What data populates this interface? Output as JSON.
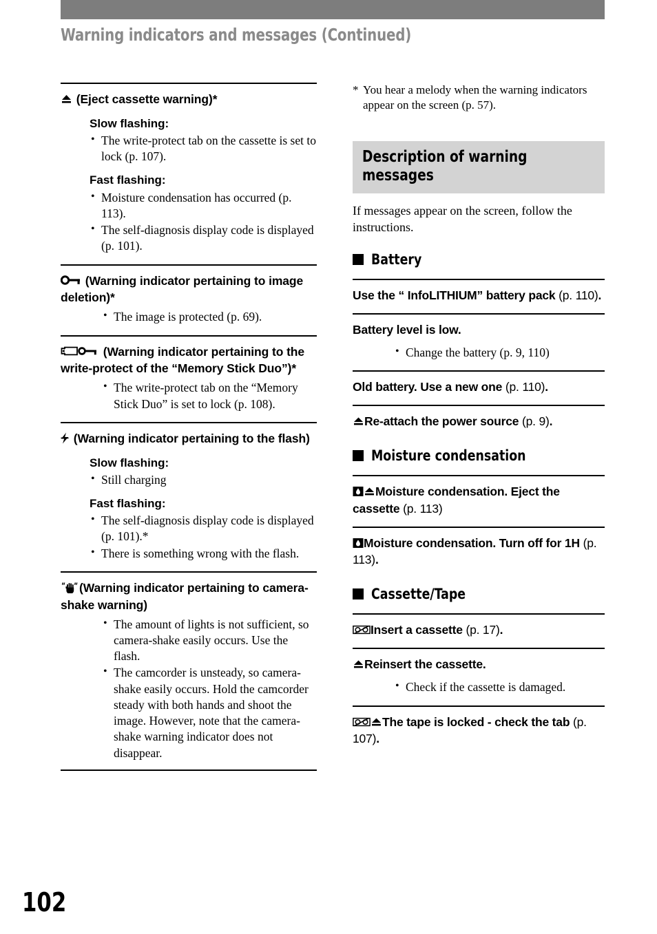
{
  "header": {
    "title": "Warning indicators and messages (Continued)",
    "bar_color": "#7d7d7d",
    "title_color": "#8a8a8a"
  },
  "folio": "102",
  "left_column": {
    "sections": [
      {
        "icon": "eject-icon",
        "heading": " (Eject cassette warning)*",
        "groups": [
          {
            "label": "Slow flashing:",
            "bullets": [
              "The write-protect tab on the cassette is set to lock (p. 107)."
            ]
          },
          {
            "label": "Fast flashing:",
            "bullets": [
              "Moisture condensation has occurred (p. 113).",
              "The self-diagnosis display code is displayed (p. 101)."
            ]
          }
        ]
      },
      {
        "icon": "key-icon",
        "heading": " (Warning indicator pertaining to image deletion)*",
        "groups": [
          {
            "label": "",
            "bullets": [
              "The image is protected (p. 69)."
            ]
          }
        ]
      },
      {
        "icon": "memory-stick-key-icon",
        "heading": " (Warning indicator pertaining to the write-protect of the “Memory Stick Duo”)*",
        "groups": [
          {
            "label": "",
            "bullets": [
              "The write-protect tab on the “Memory Stick Duo” is set to lock (p. 108)."
            ]
          }
        ]
      },
      {
        "icon": "flash-icon",
        "heading": " (Warning indicator pertaining to the flash)",
        "groups": [
          {
            "label": "Slow flashing:",
            "bullets": [
              "Still charging"
            ]
          },
          {
            "label": "Fast flashing:",
            "bullets": [
              "The self-diagnosis display code is displayed (p. 101).*",
              "There is something wrong with the flash."
            ]
          }
        ]
      },
      {
        "icon": "camera-shake-hand-icon",
        "heading": "(Warning indicator pertaining to camera-shake warning)",
        "groups": [
          {
            "label": "",
            "bullets": [
              "The amount of lights is not sufficient, so camera-shake easily occurs. Use the flash.",
              "The camcorder is unsteady, so camera-shake easily occurs. Hold the camcorder steady with both hands and shoot the image. However, note that the camera-shake warning indicator does not disappear."
            ]
          }
        ]
      }
    ]
  },
  "right_column": {
    "footnote": {
      "marker": "*",
      "text": "You hear a melody when the warning indicators appear on the screen (p. 57)."
    },
    "section_box": {
      "title": "Description of warning messages",
      "background": "#d3d3d3"
    },
    "intro": "If messages appear on the screen, follow the instructions.",
    "categories": [
      {
        "label": "Battery",
        "messages": [
          {
            "icons": [],
            "bold": "Use the “ InfoLITHIUM” battery pack",
            "page_ref": "(p. 110)",
            "trailing": ".",
            "bullets": []
          },
          {
            "icons": [],
            "bold": "Battery level is low.",
            "page_ref": "",
            "trailing": "",
            "bullets": [
              "Change the battery (p. 9, 110)"
            ]
          },
          {
            "icons": [],
            "bold": "Old battery. Use a new one",
            "page_ref": "(p. 110)",
            "trailing": ".",
            "bullets": []
          },
          {
            "icons": [
              "eject-icon"
            ],
            "bold": "Re-attach the power source",
            "page_ref": "(p. 9)",
            "trailing": ".",
            "bullets": []
          }
        ]
      },
      {
        "label": "Moisture condensation",
        "messages": [
          {
            "icons": [
              "moisture-icon",
              "eject-icon"
            ],
            "bold": "Moisture condensation. Eject the cassette",
            "page_ref": "(p. 113)",
            "trailing": "",
            "bullets": []
          },
          {
            "icons": [
              "moisture-icon"
            ],
            "bold": "Moisture condensation. Turn off for 1H",
            "page_ref": "(p. 113)",
            "trailing": ".",
            "bullets": []
          }
        ]
      },
      {
        "label": "Cassette/Tape",
        "messages": [
          {
            "icons": [
              "cassette-icon"
            ],
            "bold": "Insert a cassette",
            "page_ref": "(p. 17)",
            "trailing": ".",
            "bullets": []
          },
          {
            "icons": [
              "eject-icon"
            ],
            "bold": "Reinsert the cassette.",
            "page_ref": "",
            "trailing": "",
            "bullets": [
              "Check if the cassette is damaged."
            ]
          },
          {
            "icons": [
              "cassette-icon",
              "eject-icon"
            ],
            "bold": "The tape is locked - check the tab",
            "page_ref": "(p. 107)",
            "trailing": ".",
            "bullets": []
          }
        ]
      }
    ]
  }
}
